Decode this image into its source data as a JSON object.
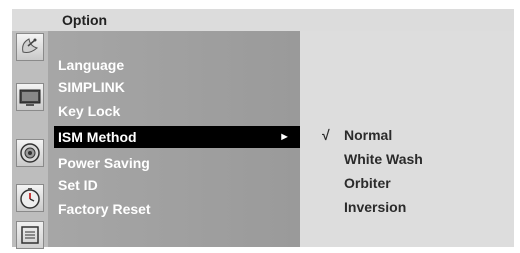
{
  "header": {
    "title": "Option"
  },
  "sidebar": {
    "icons": [
      {
        "name": "satellite-dish-icon"
      },
      {
        "name": "tv-screen-icon"
      },
      {
        "name": "speaker-icon"
      },
      {
        "name": "clock-icon"
      },
      {
        "name": "option-settings-icon"
      }
    ]
  },
  "menu": {
    "items": [
      {
        "label": "Language"
      },
      {
        "label": "SIMPLINK"
      },
      {
        "label": "Key Lock"
      },
      {
        "label": "ISM Method",
        "arrow": "►"
      },
      {
        "label": "Power Saving"
      },
      {
        "label": "Set ID"
      },
      {
        "label": "Factory Reset"
      }
    ],
    "selected_index": 3
  },
  "submenu": {
    "options": [
      {
        "label": "Normal",
        "check": "√"
      },
      {
        "label": "White Wash"
      },
      {
        "label": "Orbiter"
      },
      {
        "label": "Inversion"
      }
    ]
  },
  "colors": {
    "selected_bg": "#000000",
    "main_panel": "#a6a6a6",
    "sub_panel": "#dddddd",
    "title_bar": "#dcdcdc"
  }
}
